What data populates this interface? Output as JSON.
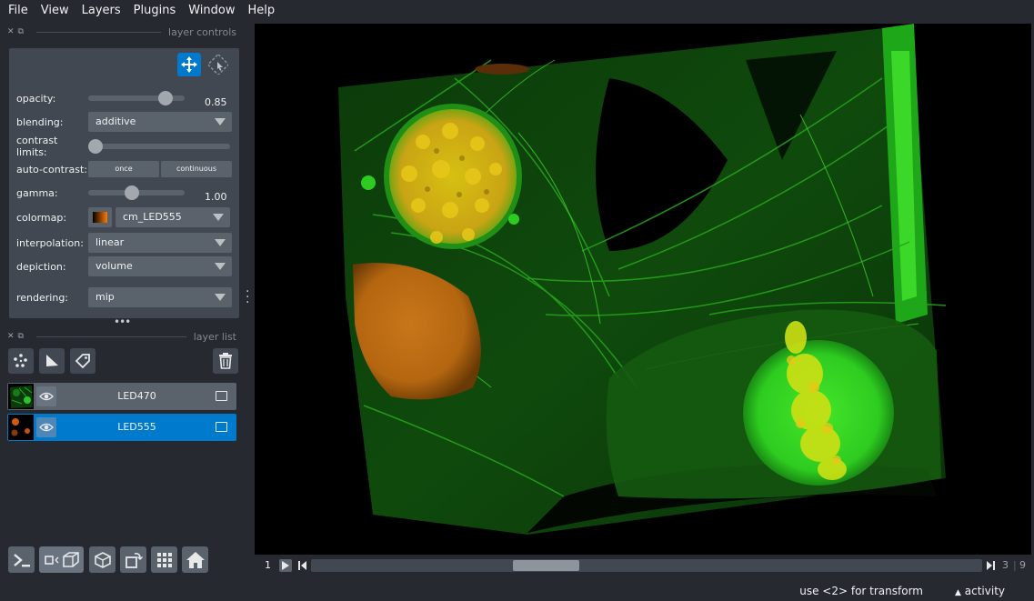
{
  "menu": [
    "File",
    "View",
    "Layers",
    "Plugins",
    "Window",
    "Help"
  ],
  "layer_controls": {
    "header": "layer controls",
    "opacity": {
      "label": "opacity:",
      "value": "0.85",
      "fraction": 0.85
    },
    "blending": {
      "label": "blending:",
      "value": "additive"
    },
    "contrast_limits": {
      "label": "contrast limits:"
    },
    "auto_contrast": {
      "label": "auto-contrast:",
      "once": "once",
      "continuous": "continuous"
    },
    "gamma": {
      "label": "gamma:",
      "value": "1.00",
      "fraction": 0.5
    },
    "colormap": {
      "label": "colormap:",
      "value": "cm_LED555"
    },
    "interpolation": {
      "label": "interpolation:",
      "value": "linear"
    },
    "depiction": {
      "label": "depiction:",
      "value": "volume"
    },
    "rendering": {
      "label": "rendering:",
      "value": "mip"
    }
  },
  "layer_list": {
    "header": "layer list",
    "layers": [
      {
        "name": "LED470",
        "selected": false
      },
      {
        "name": "LED555",
        "selected": true
      }
    ]
  },
  "dims": {
    "current": "1",
    "ticks": [
      "3",
      "9"
    ]
  },
  "status": {
    "hint": "use <2> for transform",
    "activity": "activity"
  },
  "colors": {
    "accent": "#007acc",
    "panel": "#414851",
    "bg": "#262930"
  }
}
